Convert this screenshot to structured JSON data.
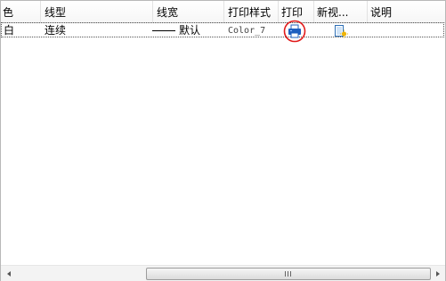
{
  "columns": {
    "color": "色",
    "linetype": "线型",
    "lineweight": "线宽",
    "plot_style": "打印样式",
    "plot": "打印",
    "new_vp": "新视...",
    "description": "说明"
  },
  "row": {
    "color": "白",
    "linetype": "连续",
    "lineweight": "默认",
    "plot_style": "Color_7",
    "plot_icon": "printer-icon",
    "new_vp_icon": "new-viewport-freeze-icon",
    "description": ""
  },
  "colors": {
    "highlight_circle": "#e11a1a",
    "printer_blue": "#1e5fbf",
    "sun_yellow": "#f0b400"
  }
}
